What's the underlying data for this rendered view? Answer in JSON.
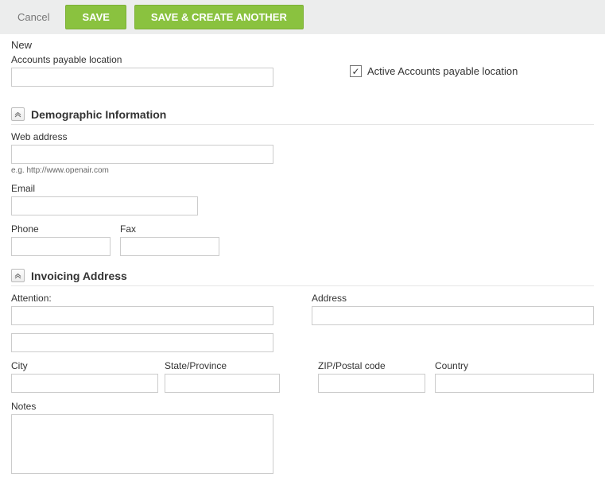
{
  "toolbar": {
    "cancel_label": "Cancel",
    "save_label": "SAVE",
    "save_create_label": "SAVE & CREATE ANOTHER"
  },
  "page": {
    "title": "New"
  },
  "location": {
    "label": "Accounts payable location",
    "value": "",
    "active_label": "Active Accounts payable location",
    "active_checked": true
  },
  "demographic": {
    "section_title": "Demographic Information",
    "web_label": "Web address",
    "web_value": "",
    "web_hint": "e.g. http://www.openair.com",
    "email_label": "Email",
    "email_value": "",
    "phone_label": "Phone",
    "phone_value": "",
    "fax_label": "Fax",
    "fax_value": ""
  },
  "invoicing": {
    "section_title": "Invoicing Address",
    "attention_label": "Attention:",
    "attention_value": "",
    "attention2_value": "",
    "address_label": "Address",
    "address_value": "",
    "city_label": "City",
    "city_value": "",
    "state_label": "State/Province",
    "state_value": "",
    "zip_label": "ZIP/Postal code",
    "zip_value": "",
    "country_label": "Country",
    "country_value": "",
    "notes_label": "Notes",
    "notes_value": ""
  }
}
